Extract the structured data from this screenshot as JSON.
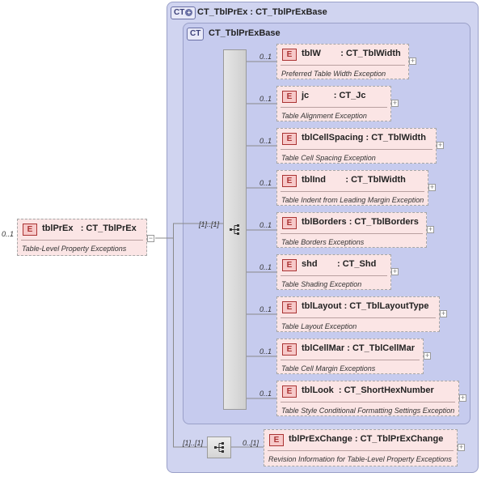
{
  "root": {
    "cardinality": "0..1",
    "badge": "E",
    "name": "tblPrEx",
    "type": ": CT_TblPrEx",
    "description": "Table-Level Property Exceptions",
    "expander": "−"
  },
  "complex_type": {
    "badge": "CT",
    "title": "CT_TblPrEx : CT_TblPrExBase",
    "base": {
      "badge": "CT",
      "title": "CT_TblPrExBase"
    }
  },
  "sequence_cardinality": "[1]..[1]",
  "change_sequence_cardinality": "[1]..[1]",
  "children": [
    {
      "cardinality": "0..1",
      "badge": "E",
      "name": "tblW",
      "type": ": CT_TblWidth",
      "description": "Preferred Table Width Exception",
      "expander": "+"
    },
    {
      "cardinality": "0..1",
      "badge": "E",
      "name": "jc",
      "type": ": CT_Jc",
      "description": "Table Alignment Exception",
      "expander": "+"
    },
    {
      "cardinality": "0..1",
      "badge": "E",
      "name": "tblCellSpacing",
      "type": ": CT_TblWidth",
      "description": "Table Cell Spacing Exception",
      "expander": "+"
    },
    {
      "cardinality": "0..1",
      "badge": "E",
      "name": "tblInd",
      "type": ": CT_TblWidth",
      "description": "Table Indent from Leading Margin Exception",
      "expander": "+"
    },
    {
      "cardinality": "0..1",
      "badge": "E",
      "name": "tblBorders",
      "type": ": CT_TblBorders",
      "description": "Table Borders Exceptions",
      "expander": "+"
    },
    {
      "cardinality": "0..1",
      "badge": "E",
      "name": "shd",
      "type": ": CT_Shd",
      "description": "Table Shading Exception",
      "expander": "+"
    },
    {
      "cardinality": "0..1",
      "badge": "E",
      "name": "tblLayout",
      "type": ": CT_TblLayoutType",
      "description": "Table Layout Exception",
      "expander": "+"
    },
    {
      "cardinality": "0..1",
      "badge": "E",
      "name": "tblCellMar",
      "type": ": CT_TblCellMar",
      "description": "Table Cell Margin Exceptions",
      "expander": "+"
    },
    {
      "cardinality": "0..1",
      "badge": "E",
      "name": "tblLook",
      "type": ": CT_ShortHexNumber",
      "description": "Table Style Conditional Formatting Settings Exception",
      "expander": "+"
    }
  ],
  "change_element": {
    "cardinality": "0..[1]",
    "badge": "E",
    "name": "tblPrExChange",
    "type": ": CT_TblPrExChange",
    "description": "Revision Information for Table-Level Property Exceptions",
    "expander": "+"
  }
}
